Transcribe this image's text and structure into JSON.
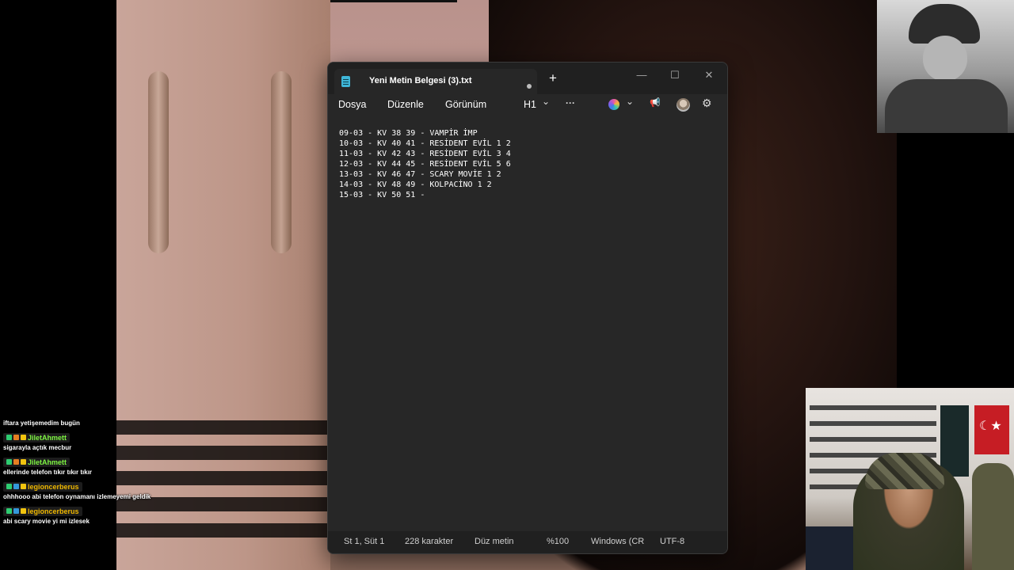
{
  "notepad": {
    "tab_title": "Yeni Metin Belgesi (3).txt",
    "add_tab_glyph": "+",
    "window_controls": {
      "minimize": "—",
      "maximize": "☐",
      "close": "✕"
    },
    "menu": {
      "file": "Dosya",
      "edit": "Düzenle",
      "view": "Görünüm",
      "heading": "H1",
      "heading_chevron": "⌄",
      "more": "···",
      "copilot_chevron": "⌄"
    },
    "icons": {
      "announce": "📢",
      "settings": "⚙"
    },
    "lines": [
      "09-03 - KV 38 39 - VAMPİR İMP",
      "10-03 - KV 40 41 - RESİDENT EVİL 1 2",
      "11-03 - KV 42 43 - RESİDENT EVİL 3 4",
      "12-03 - KV 44 45 - RESİDENT EVİL 5 6",
      "13-03 - KV 46 47 - SCARY MOVİE 1 2",
      "14-03 - KV 48 49 - KOLPACİNO 1 2",
      "15-03 - KV 50 51 -"
    ],
    "status": {
      "position": "St 1, Süt 1",
      "characters": "228 karakter",
      "format": "Düz metin",
      "zoom": "%100",
      "line_ending": "Windows (CR",
      "encoding": "UTF-8"
    }
  },
  "chat": {
    "first_text": "iftara yetişemedim bugün",
    "messages": [
      {
        "user": "JiletAhmett",
        "user_color": "#7ef542",
        "text": "sigarayla açtık mecbur"
      },
      {
        "user": "JiletAhmett",
        "user_color": "#7ef542",
        "text": "ellerinde telefon tıkır tıkır tıkır"
      },
      {
        "user": "legioncerberus",
        "user_color": "#f0b800",
        "text": "ohhhooo abi telefon oynamanı izlemeyemi geldik"
      },
      {
        "user": "legioncerberus",
        "user_color": "#f0b800",
        "text": "abi scary movie yi mi izlesek"
      }
    ]
  },
  "colors": {
    "accent_green": "#7ef542",
    "accent_gold": "#f0b800",
    "editor_bg": "#272727",
    "titlebar_bg": "#202020"
  }
}
